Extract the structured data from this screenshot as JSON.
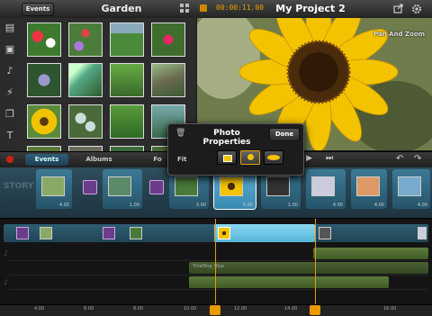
{
  "topbar": {
    "events_label": "Events",
    "library_title": "Garden",
    "timecode": "00:00:11.00",
    "project_title": "My Project 2"
  },
  "left_tools": [
    "clip-icon",
    "photo-icon",
    "music-icon",
    "effects-icon",
    "copy-icon",
    "text-icon"
  ],
  "preview": {
    "overlay_label": "Pan And Zoom"
  },
  "control_row": {
    "tabs": [
      "Events",
      "Albums",
      "Fo"
    ]
  },
  "storyboard": {
    "durations": [
      "4.00",
      "1.00",
      "3.00",
      "5.00",
      "1.00",
      "4.00",
      "4.00",
      "4.00",
      "4.00",
      "4.00"
    ]
  },
  "timeline": {
    "audio_clip_label": "Thiefling_Blue",
    "ruler_ticks": [
      "4.00",
      "8.00",
      "8.00",
      "10.00",
      "12.00",
      "14.00",
      "16.00"
    ]
  },
  "popup": {
    "title": "Photo Properties",
    "done_label": "Done",
    "fit_label": "Fit",
    "selected_fit": "fit"
  },
  "colors": {
    "accent": "#e89a00",
    "story_bg": "#2f4d5c",
    "video_track": "#2e5d72",
    "audio_clip": "#5d7a3c"
  }
}
